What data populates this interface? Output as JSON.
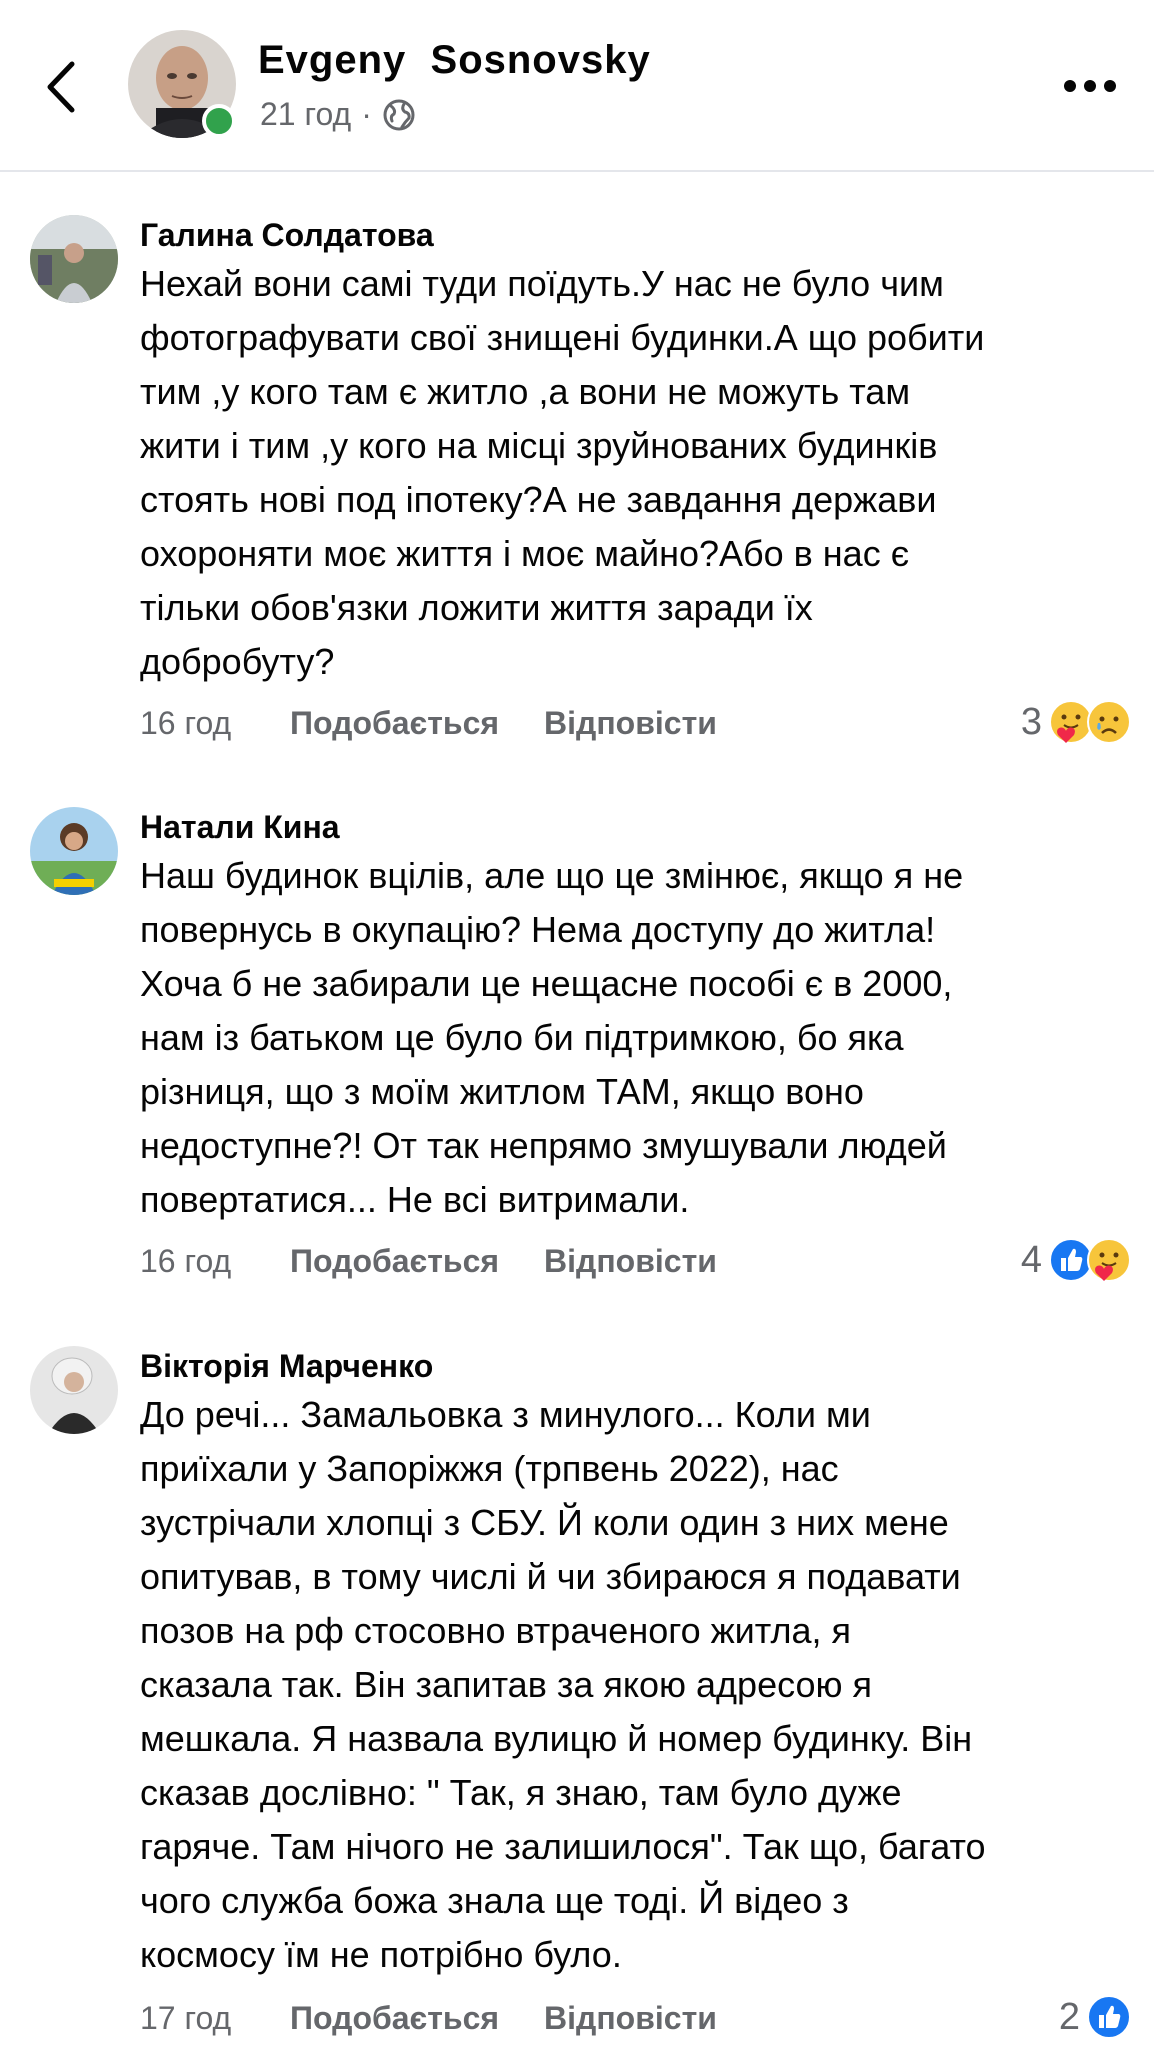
{
  "header": {
    "author_name": "Evgeny  Sosnovsky",
    "time": "21 год",
    "separator": "·"
  },
  "comments": [
    {
      "name": "Галина Солдатова",
      "text": "Нехай вони самі туди поїдуть.У нас не було чим\nфотографувати свої знищені будинки.А що робити\nтим ,у кого там є житло ,а вони не можуть  там\nжити і тим ,у кого на місці зруйнованих будинків\nстоять нові под іпотеку?А не завдання держави\nохороняти моє життя і моє майно?Або в нас є\nтільки обов'язки ложити життя заради їх\nдобробуту?",
      "time": "16 год",
      "like_label": "Подобається",
      "reply_label": "Відповісти",
      "reaction_count": "3",
      "reactions": [
        "care-icon",
        "sad-icon"
      ]
    },
    {
      "name": "Натали Кина",
      "text": "Наш будинок вцілів, але що це змінює, якщо я не\nповернусь в окупацію? Нема доступу до житла!\nХоча б не забирали це нещасне пособі є в 2000,\nнам із батьком це було би підтримкою, бо яка\nрізниця, що з моїм житлом ТАМ, якщо воно\nнедоступне?! От так непрямо змушували людей\nповертатися... Не всі витримали.",
      "time": "16 год",
      "like_label": "Подобається",
      "reply_label": "Відповісти",
      "reaction_count": "4",
      "reactions": [
        "like-icon",
        "care-icon"
      ]
    },
    {
      "name": "Вікторія Марченко",
      "text": "До речі... Замальовка з минулого... Коли ми\nприїхали у Запоріжжя (трпвень 2022), нас\nзустрічали хлопці з СБУ. Й коли один з них мене\nопитував, в тому числі й чи збираюся я подавати\nпозов на рф стосовно втраченого житла, я\nсказала так. Він запитав за якою адресою я\nмешкала. Я назвала вулицю й номер будинку. Він\nсказав дослівно: \" Так, я знаю, там було дуже\nгаряче. Там нічого не залишилося\". Так що, багато\nчого служба божа знала ще тоді. Й відео з\nкосмосу їм не потрібно було.",
      "time": "17 год",
      "like_label": "Подобається",
      "reply_label": "Відповісти",
      "reaction_count": "2",
      "reactions": [
        "like-icon"
      ]
    }
  ]
}
